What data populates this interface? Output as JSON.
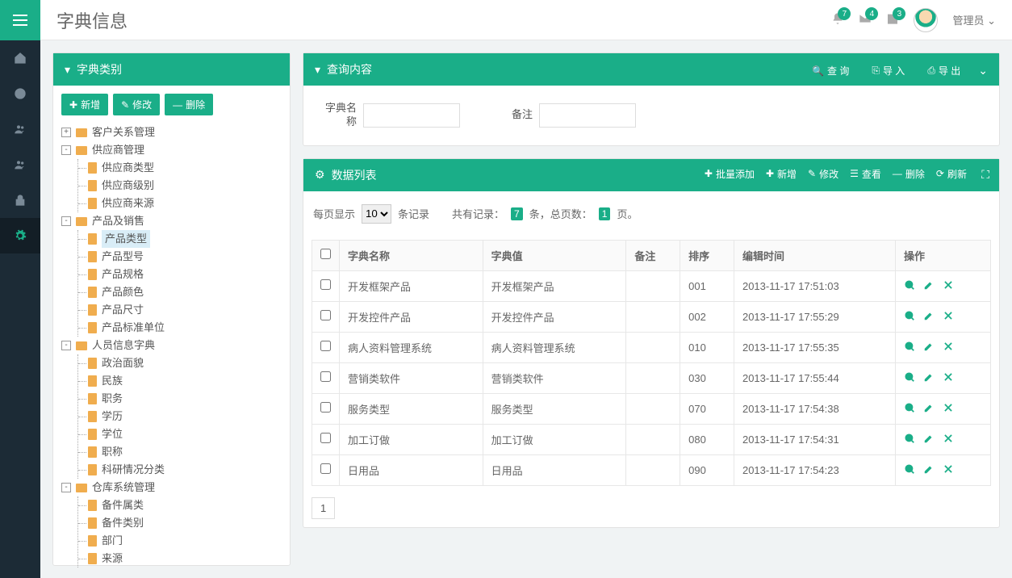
{
  "header": {
    "title": "字典信息",
    "notifications": [
      {
        "icon": "bell",
        "count": "7"
      },
      {
        "icon": "mail",
        "count": "4"
      },
      {
        "icon": "calendar",
        "count": "3"
      }
    ],
    "username": "管理员"
  },
  "sidebar_nav": [
    {
      "icon": "home"
    },
    {
      "icon": "globe"
    },
    {
      "icon": "users"
    },
    {
      "icon": "users"
    },
    {
      "icon": "lock"
    },
    {
      "icon": "gear",
      "active": true
    }
  ],
  "left_panel": {
    "title": "字典类别",
    "buttons": {
      "add": "新增",
      "edit": "修改",
      "delete": "删除"
    },
    "tree": [
      {
        "label": "客户关系管理",
        "type": "folder",
        "expand": "+"
      },
      {
        "label": "供应商管理",
        "type": "folder",
        "expand": "-",
        "children": [
          {
            "label": "供应商类型"
          },
          {
            "label": "供应商级别"
          },
          {
            "label": "供应商来源"
          }
        ]
      },
      {
        "label": "产品及销售",
        "type": "folder",
        "expand": "-",
        "children": [
          {
            "label": "产品类型",
            "selected": true
          },
          {
            "label": "产品型号"
          },
          {
            "label": "产品规格"
          },
          {
            "label": "产品颜色"
          },
          {
            "label": "产品尺寸"
          },
          {
            "label": "产品标准单位"
          }
        ]
      },
      {
        "label": "人员信息字典",
        "type": "folder",
        "expand": "-",
        "children": [
          {
            "label": "政治面貌"
          },
          {
            "label": "民族"
          },
          {
            "label": "职务"
          },
          {
            "label": "学历"
          },
          {
            "label": "学位"
          },
          {
            "label": "职称"
          },
          {
            "label": "科研情况分类"
          }
        ]
      },
      {
        "label": "仓库系统管理",
        "type": "folder",
        "expand": "-",
        "children": [
          {
            "label": "备件属类"
          },
          {
            "label": "备件类别"
          },
          {
            "label": "部门"
          },
          {
            "label": "来源"
          }
        ]
      }
    ]
  },
  "query_panel": {
    "title": "查询内容",
    "buttons": {
      "search": "查 询",
      "import": "导 入",
      "export": "导 出"
    },
    "fields": {
      "name_label": "字典名称",
      "note_label": "备注"
    }
  },
  "data_panel": {
    "title": "数据列表",
    "toolbar": {
      "batch_add": "批量添加",
      "add": "新增",
      "edit": "修改",
      "view": "查看",
      "delete": "删除",
      "refresh": "刷新"
    },
    "paging": {
      "per_page_prefix": "每页显示",
      "per_page_value": "10",
      "per_page_suffix": "条记录",
      "total_prefix": "共有记录：",
      "total_count": "7",
      "total_mid": "条，总页数：",
      "total_pages": "1",
      "total_suffix": "页。"
    },
    "columns": [
      "字典名称",
      "字典值",
      "备注",
      "排序",
      "编辑时间",
      "操作"
    ],
    "rows": [
      {
        "name": "开发框架产品",
        "value": "开发框架产品",
        "note": "",
        "sort": "001",
        "time": "2013-11-17 17:51:03"
      },
      {
        "name": "开发控件产品",
        "value": "开发控件产品",
        "note": "",
        "sort": "002",
        "time": "2013-11-17 17:55:29"
      },
      {
        "name": "病人资料管理系统",
        "value": "病人资料管理系统",
        "note": "",
        "sort": "010",
        "time": "2013-11-17 17:55:35"
      },
      {
        "name": "营销类软件",
        "value": "营销类软件",
        "note": "",
        "sort": "030",
        "time": "2013-11-17 17:55:44"
      },
      {
        "name": "服务类型",
        "value": "服务类型",
        "note": "",
        "sort": "070",
        "time": "2013-11-17 17:54:38"
      },
      {
        "name": "加工订做",
        "value": "加工订做",
        "note": "",
        "sort": "080",
        "time": "2013-11-17 17:54:31"
      },
      {
        "name": "日用品",
        "value": "日用品",
        "note": "",
        "sort": "090",
        "time": "2013-11-17 17:54:23"
      }
    ],
    "pager_current": "1"
  }
}
